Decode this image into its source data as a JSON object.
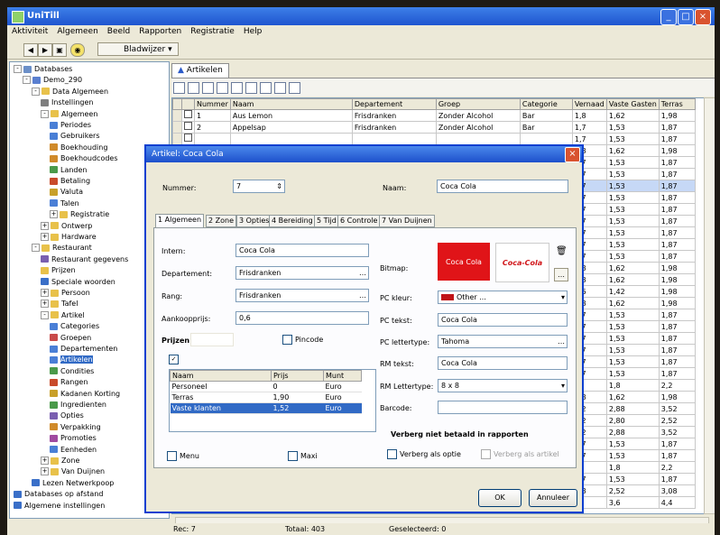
{
  "window": {
    "title": "UniTill"
  },
  "menu": [
    "Aktiviteit",
    "Algemeen",
    "Beeld",
    "Rapporten",
    "Registratie",
    "Help"
  ],
  "toolbar": {
    "dropdown": "Bladwijzer"
  },
  "tree": [
    {
      "label": "Databases",
      "level": 0,
      "tw": "-",
      "color": "#6b8fc8"
    },
    {
      "label": "Demo_290",
      "level": 1,
      "tw": "-",
      "color": "#5a7fd0"
    },
    {
      "label": "Data Algemeen",
      "level": 2,
      "tw": "-",
      "color": "#e8c14a"
    },
    {
      "label": "Instellingen",
      "level": 3,
      "tw": "",
      "color": "#7f7f7f"
    },
    {
      "label": "Algemeen",
      "level": 3,
      "tw": "-",
      "color": "#e8c14a"
    },
    {
      "label": "Periodes",
      "level": 4,
      "tw": "",
      "color": "#4a7fd6"
    },
    {
      "label": "Gebruikers",
      "level": 4,
      "tw": "",
      "color": "#4a7fd6"
    },
    {
      "label": "Boekhouding",
      "level": 4,
      "tw": "",
      "color": "#d08a2a"
    },
    {
      "label": "Boekhoudcodes",
      "level": 4,
      "tw": "",
      "color": "#d08a2a"
    },
    {
      "label": "Landen",
      "level": 4,
      "tw": "",
      "color": "#4a9a4a"
    },
    {
      "label": "Betaling",
      "level": 4,
      "tw": "",
      "color": "#c84a2a"
    },
    {
      "label": "Valuta",
      "level": 4,
      "tw": "",
      "color": "#c8a02a"
    },
    {
      "label": "Talen",
      "level": 4,
      "tw": "",
      "color": "#4a7fd6"
    },
    {
      "label": "Registratie",
      "level": 4,
      "tw": "+",
      "color": "#e8c14a"
    },
    {
      "label": "Ontwerp",
      "level": 3,
      "tw": "+",
      "color": "#e8c14a"
    },
    {
      "label": "Hardware",
      "level": 3,
      "tw": "+",
      "color": "#e8c14a"
    },
    {
      "label": "Restaurant",
      "level": 2,
      "tw": "-",
      "color": "#e8c14a"
    },
    {
      "label": "Restaurant gegevens",
      "level": 3,
      "tw": "",
      "color": "#7a5fb0"
    },
    {
      "label": "Prijzen",
      "level": 3,
      "tw": "",
      "color": "#e8c14a"
    },
    {
      "label": "Speciale woorden",
      "level": 3,
      "tw": "",
      "color": "#3a6fc8"
    },
    {
      "label": "Persoon",
      "level": 3,
      "tw": "+",
      "color": "#e8c14a"
    },
    {
      "label": "Tafel",
      "level": 3,
      "tw": "+",
      "color": "#e8c14a"
    },
    {
      "label": "Artikel",
      "level": 3,
      "tw": "-",
      "color": "#e8c14a"
    },
    {
      "label": "Categories",
      "level": 4,
      "tw": "",
      "color": "#4a7fd6"
    },
    {
      "label": "Groepen",
      "level": 4,
      "tw": "",
      "color": "#c84a4a"
    },
    {
      "label": "Departementen",
      "level": 4,
      "tw": "",
      "color": "#4a7fd6"
    },
    {
      "label": "Artikelen",
      "level": 4,
      "tw": "",
      "color": "#4a7fd6",
      "selected": true
    },
    {
      "label": "Condities",
      "level": 4,
      "tw": "",
      "color": "#4a9a4a"
    },
    {
      "label": "Rangen",
      "level": 4,
      "tw": "",
      "color": "#c84a2a"
    },
    {
      "label": "Kadanen Korting",
      "level": 4,
      "tw": "",
      "color": "#c8a02a"
    },
    {
      "label": "Ingredienten",
      "level": 4,
      "tw": "",
      "color": "#4a9a4a"
    },
    {
      "label": "Opties",
      "level": 4,
      "tw": "",
      "color": "#7a5fb0"
    },
    {
      "label": "Verpakking",
      "level": 4,
      "tw": "",
      "color": "#d08a2a"
    },
    {
      "label": "Promoties",
      "level": 4,
      "tw": "",
      "color": "#a04aa0"
    },
    {
      "label": "Eenheden",
      "level": 4,
      "tw": "",
      "color": "#4a7fd6"
    },
    {
      "label": "Zone",
      "level": 3,
      "tw": "+",
      "color": "#e8c14a"
    },
    {
      "label": "Van Duijnen",
      "level": 3,
      "tw": "+",
      "color": "#e8c14a"
    },
    {
      "label": "Lezen Netwerkpoop",
      "level": 2,
      "tw": "",
      "color": "#3a6fc8"
    },
    {
      "label": "Databases op afstand",
      "level": 0,
      "tw": "",
      "color": "#3a6fc8"
    },
    {
      "label": "Algemene instellingen",
      "level": 0,
      "tw": "",
      "color": "#3a6fc8"
    }
  ],
  "tab": {
    "label": "Artikelen"
  },
  "grid": {
    "headers": [
      "",
      "Nummer",
      "Naam",
      "Departement",
      "Groep",
      "Categorie",
      "Vernaad",
      "Vaste Gasten",
      "Terras"
    ],
    "rows": [
      [
        "",
        "1",
        "Aus Lemon",
        "Frisdranken",
        "Zonder Alcohol",
        "Bar",
        "1,8",
        "1,62",
        "1,98"
      ],
      [
        "",
        "2",
        "Appelsap",
        "Frisdranken",
        "Zonder Alcohol",
        "Bar",
        "1,7",
        "1,53",
        "1,87"
      ],
      [
        "",
        "",
        "",
        "",
        "",
        "",
        "1,7",
        "1,53",
        "1,87"
      ],
      [
        "",
        "",
        "",
        "",
        "",
        "",
        "1,8",
        "1,62",
        "1,98"
      ],
      [
        "",
        "",
        "",
        "",
        "",
        "",
        "1,7",
        "1,53",
        "1,87"
      ],
      [
        "",
        "",
        "",
        "",
        "",
        "",
        "1,7",
        "1,53",
        "1,87"
      ],
      [
        "",
        "",
        "",
        "",
        "",
        "",
        "1,7",
        "1,53",
        "1,87"
      ],
      [
        "",
        "",
        "",
        "",
        "",
        "",
        "1,7",
        "1,53",
        "1,87"
      ],
      [
        "",
        "",
        "",
        "",
        "",
        "",
        "1,7",
        "1,53",
        "1,87"
      ],
      [
        "",
        "",
        "",
        "",
        "",
        "",
        "1,7",
        "1,53",
        "1,87"
      ],
      [
        "",
        "",
        "",
        "",
        "",
        "",
        "1,7",
        "1,53",
        "1,87"
      ],
      [
        "",
        "",
        "",
        "",
        "",
        "",
        "1,7",
        "1,53",
        "1,87"
      ],
      [
        "",
        "",
        "",
        "",
        "",
        "",
        "1,7",
        "1,53",
        "1,87"
      ],
      [
        "",
        "",
        "",
        "",
        "",
        "",
        "1,8",
        "1,62",
        "1,98"
      ],
      [
        "",
        "",
        "",
        "",
        "",
        "",
        "1,8",
        "1,62",
        "1,98"
      ],
      [
        "",
        "",
        "",
        "",
        "",
        "",
        "1,6",
        "1,42",
        "1,98"
      ],
      [
        "",
        "",
        "",
        "",
        "",
        "",
        "1,8",
        "1,62",
        "1,98"
      ],
      [
        "",
        "",
        "",
        "",
        "",
        "",
        "1,7",
        "1,53",
        "1,87"
      ],
      [
        "",
        "",
        "",
        "",
        "",
        "",
        "1,7",
        "1,53",
        "1,87"
      ],
      [
        "",
        "",
        "",
        "",
        "",
        "",
        "1,7",
        "1,53",
        "1,87"
      ],
      [
        "",
        "",
        "",
        "",
        "",
        "",
        "1,7",
        "1,53",
        "1,87"
      ],
      [
        "",
        "",
        "",
        "",
        "",
        "",
        "1,7",
        "1,53",
        "1,87"
      ],
      [
        "",
        "",
        "",
        "",
        "",
        "",
        "1,7",
        "1,53",
        "1,87"
      ],
      [
        "",
        "",
        "",
        "",
        "",
        "",
        "2",
        "1,8",
        "2,2"
      ],
      [
        "",
        "",
        "",
        "",
        "",
        "",
        "1,8",
        "1,62",
        "1,98"
      ],
      [
        "",
        "",
        "",
        "",
        "",
        "",
        "3,2",
        "2,88",
        "3,52"
      ],
      [
        "",
        "",
        "",
        "",
        "",
        "",
        "2,2",
        "2,80",
        "2,52"
      ],
      [
        "",
        "",
        "",
        "",
        "",
        "",
        "3,2",
        "2,88",
        "3,52"
      ],
      [
        "",
        "",
        "",
        "",
        "",
        "",
        "1,7",
        "1,53",
        "1,87"
      ],
      [
        "",
        "",
        "",
        "",
        "",
        "",
        "1,7",
        "1,53",
        "1,87"
      ],
      [
        "",
        "",
        "",
        "",
        "",
        "",
        "2",
        "1,8",
        "2,2"
      ],
      [
        "",
        "",
        "",
        "",
        "",
        "",
        "1,7",
        "1,53",
        "1,87"
      ],
      [
        "",
        "",
        "",
        "",
        "",
        "",
        "2,8",
        "2,52",
        "3,08"
      ],
      [
        "",
        "",
        "",
        "",
        "",
        "",
        "4",
        "3,6",
        "4,4"
      ]
    ],
    "selected_row": 6
  },
  "status": {
    "rec": "Rec: 7",
    "total": "Totaal: 403",
    "selected": "Geselecteerd: 0"
  },
  "dialog": {
    "title": "Artikel: Coca Cola",
    "nummer_label": "Nummer:",
    "nummer_value": "7",
    "naam_label": "Naam:",
    "naam_value": "Coca Cola",
    "tabs": [
      "1 Algemeen",
      "2 Zone",
      "3 Opties",
      "4 Bereiding",
      "5 Tijd",
      "6 Controle",
      "7 Van Duijnen"
    ],
    "intern_label": "Intern:",
    "intern_value": "Coca Cola",
    "departement_label": "Departement:",
    "departement_value": "Frisdranken",
    "rang_label": "Rang:",
    "rang_value": "Frisdranken",
    "aankoopprijs_label": "Aankoopprijs:",
    "aankoopprijs_value": "0,6",
    "prijzen_label": "Prijzen:",
    "pincode_label": "Pincode",
    "prices": {
      "headers": [
        "Naam",
        "Prijs",
        "Munt"
      ],
      "rows": [
        [
          "Personeel",
          "0",
          "Euro"
        ],
        [
          "Terras",
          "1,90",
          "Euro"
        ],
        [
          "Vaste klanten",
          "1,52",
          "Euro"
        ]
      ]
    },
    "menu_label": "Menu",
    "maxi_label": "Maxi",
    "bitmap_label": "Bitmap:",
    "logo1": "Coca Cola",
    "logo2": "Coca-Cola",
    "pc_kleur_label": "PC kleur:",
    "pc_kleur_value": "Other ...",
    "pc_tekst_label": "PC tekst:",
    "pc_tekst_value": "Coca Cola",
    "pc_lettertype_label": "PC lettertype:",
    "pc_lettertype_value": "Tahoma",
    "rm_tekst_label": "RM tekst:",
    "rm_tekst_value": "Coca Cola",
    "rm_lettertype_label": "RM Lettertype:",
    "rm_lettertype_value": "8 x 8",
    "barcode_label": "Barcode:",
    "verberg_title": "Verberg niet betaald in rapporten",
    "verberg_optie": "Verberg als optie",
    "verberg_artikel": "Verberg als artikel",
    "ok": "OK",
    "annuleer": "Annuleer"
  }
}
